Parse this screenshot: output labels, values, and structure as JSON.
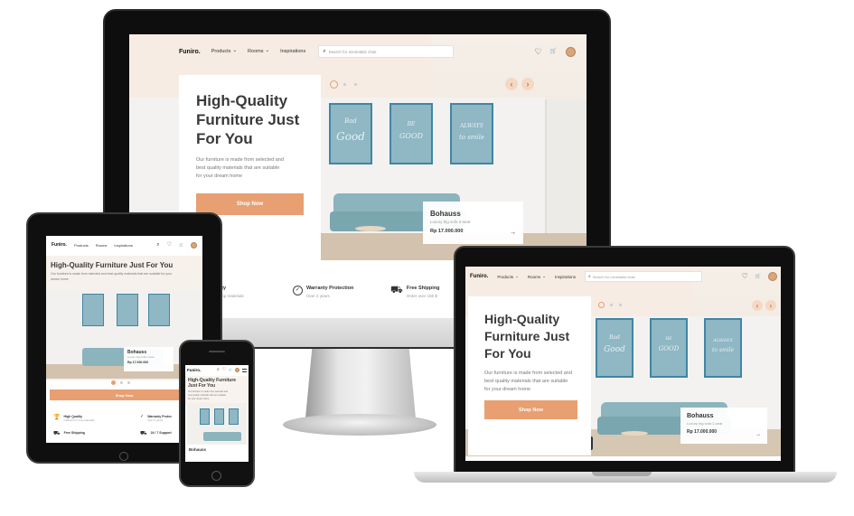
{
  "brand": "Funiro.",
  "nav": {
    "products": "Products",
    "rooms": "Rooms",
    "inspirations": "Inspirations"
  },
  "search_placeholder": "Search for minimalist chair",
  "hero": {
    "title_line1": "High-Quality",
    "title_line2": "Furniture Just",
    "title_line3": "For You",
    "title_compact_1": "High-Quality Furniture Just For You",
    "title_phone_1": "High-Quality Furniture",
    "title_phone_2": "Just For You",
    "desc1": "Our furniture is made from selected and",
    "desc2": "best quality materials that are suitable",
    "desc3": "for your dream home",
    "desc_tablet_1": "Our furniture is made from selected and best quality materials that are suitable for your",
    "desc_tablet_2": "dream home",
    "shop_label": "Shop Now"
  },
  "product": {
    "name": "Bohauss",
    "subtitle": "Luxury big sofa 2-seat",
    "price": "Rp 17.000.000",
    "arrow": "→"
  },
  "features": {
    "quality_title": "High Quality",
    "quality_title_cut": "ality",
    "quality_sub": "crafted from top materials",
    "quality_sub_cut": "m top materials",
    "warranty_title": "Warranty Protection",
    "warranty_title_cut": "Warranty Protec",
    "warranty_sub": "Over 2 years",
    "shipping_title": "Free Shipping",
    "shipping_sub": "Order over 150 $",
    "support_title": "24 / 7 Support"
  },
  "frames": {
    "f1a": "Bad",
    "f1b": "Good",
    "f2a": "BE",
    "f2b": "GOOD",
    "f3a": "ALWAYS",
    "f3b": "to smile"
  },
  "icons": {
    "chevron": "⌄",
    "heart": "♡",
    "cart": "🛒",
    "search": "⌕",
    "prev": "‹",
    "next": "›",
    "check": "✓",
    "trophy": "🏆",
    "truck": "⛟"
  },
  "colors": {
    "accent": "#e89f71",
    "frame": "#3f86a3"
  }
}
